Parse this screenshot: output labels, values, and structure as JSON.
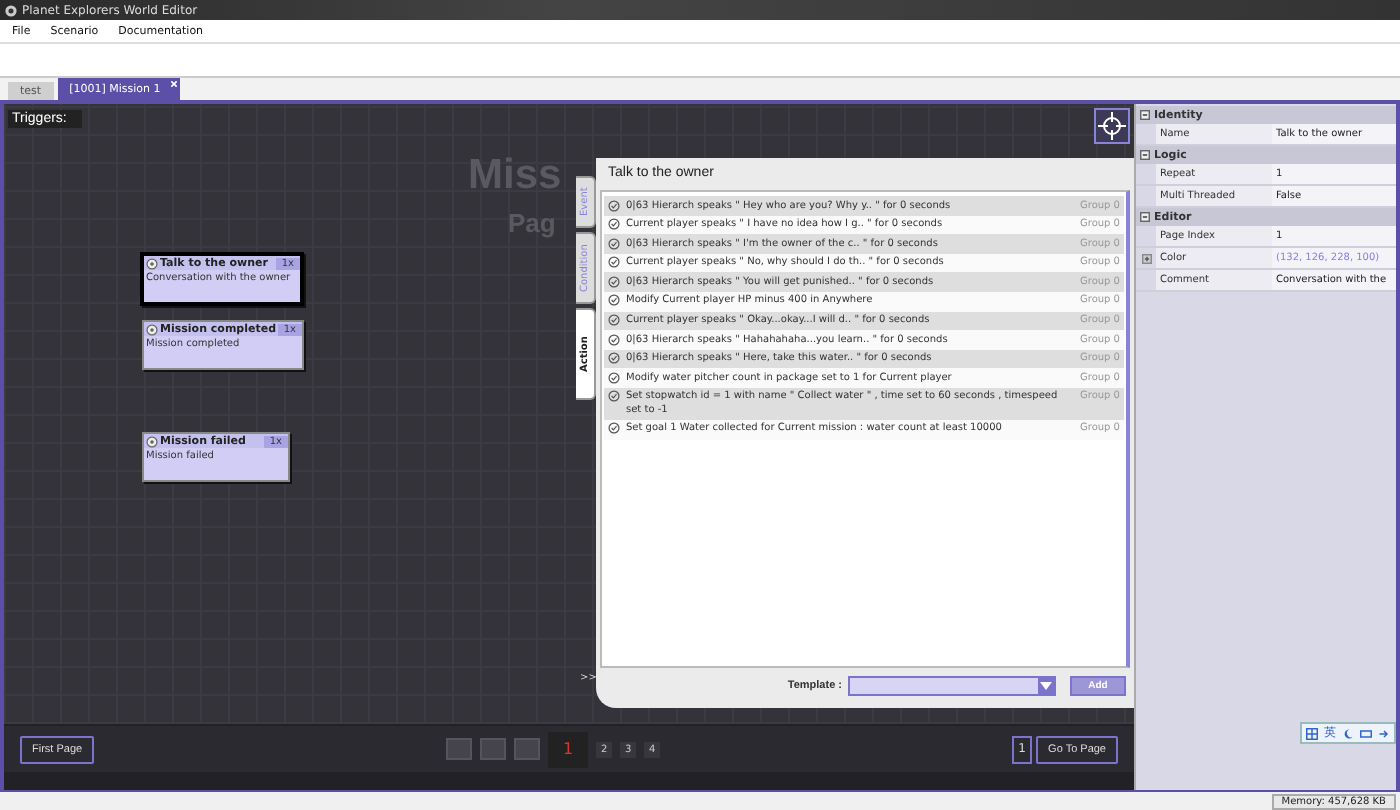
{
  "window": {
    "title": "Planet Explorers World Editor"
  },
  "menu": [
    "File",
    "Scenario",
    "Documentation"
  ],
  "tabs": [
    {
      "label": "test",
      "selected": false,
      "closable": false
    },
    {
      "label": "[1001] Mission 1",
      "selected": true,
      "closable": true
    }
  ],
  "canvas": {
    "label": "Triggers:",
    "watermark_title": "Miss",
    "watermark_subtitle": "Pag",
    "nodes": [
      {
        "title": "Talk to the owner",
        "repeat": "1x",
        "description": "Conversation with the owner",
        "selected": true
      },
      {
        "title": "Mission completed",
        "repeat": "1x",
        "description": "Mission completed",
        "selected": false
      },
      {
        "title": "Mission failed",
        "repeat": "1x",
        "description": "Mission failed",
        "selected": false
      }
    ]
  },
  "editor": {
    "side_tabs": [
      {
        "label": "Event",
        "selected": false
      },
      {
        "label": "Condition",
        "selected": false
      },
      {
        "label": "Action",
        "selected": true
      }
    ],
    "title": "Talk to the owner",
    "actions": [
      {
        "text": "0|63 Hierarch speaks \" Hey who are you? Why y.. \" for 0 seconds",
        "group": "Group 0"
      },
      {
        "text": "Current player speaks \" I have no idea how I g.. \" for 0 seconds",
        "group": "Group 0"
      },
      {
        "text": "0|63 Hierarch speaks \" I'm the owner of the c.. \" for 0 seconds",
        "group": "Group 0"
      },
      {
        "text": "Current player speaks \" No, why should I do th.. \" for 0 seconds",
        "group": "Group 0"
      },
      {
        "text": "0|63 Hierarch speaks \" You will get punished.. \" for 0 seconds",
        "group": "Group 0"
      },
      {
        "text": "Modify Current player HP minus 400 in Anywhere",
        "group": "Group 0"
      },
      {
        "text": "Current player speaks \" Okay...okay...I will d.. \" for 0 seconds",
        "group": "Group 0"
      },
      {
        "text": "0|63 Hierarch speaks \" Hahahahaha...you learn.. \" for 0 seconds",
        "group": "Group 0"
      },
      {
        "text": "0|63 Hierarch speaks \" Here, take this water.. \" for 0 seconds",
        "group": "Group 0"
      },
      {
        "text": "Modify water pitcher count in package set to 1 for Current player",
        "group": "Group 0"
      },
      {
        "text": "Set stopwatch id = 1 with name \" Collect water \" , time set to 60 seconds , timespeed set to -1",
        "group": "Group 0"
      },
      {
        "text": "Set goal 1 Water collected for Current mission : water count at least 10000",
        "group": "Group 0"
      }
    ],
    "template_label": "Template :",
    "add_button": "Add",
    "collapse": ">>"
  },
  "pager": {
    "first": "First Page",
    "pages": [
      {
        "label": "1",
        "selected": true
      },
      {
        "label": "2",
        "selected": false
      },
      {
        "label": "3",
        "selected": false
      },
      {
        "label": "4",
        "selected": false
      }
    ],
    "page_input": "1",
    "go_button": "Go To Page"
  },
  "properties": [
    {
      "category": "Identity",
      "expanded": true,
      "rows": [
        {
          "name": "Name",
          "value": "Talk to the owner"
        }
      ]
    },
    {
      "category": "Logic",
      "expanded": true,
      "rows": [
        {
          "name": "Repeat",
          "value": "1"
        },
        {
          "name": "Multi Threaded",
          "value": "False"
        }
      ]
    },
    {
      "category": "Editor",
      "expanded": true,
      "rows": [
        {
          "name": "Page Index",
          "value": "1"
        },
        {
          "name": "Color",
          "value": "(132, 126, 228, 100)",
          "expandable": true,
          "color": "#847ee4"
        },
        {
          "name": "Comment",
          "value": "Conversation with the"
        }
      ]
    }
  ],
  "ime": {
    "label": "英"
  },
  "status_bar": {
    "memory": "Memory: 457,628 KB"
  }
}
